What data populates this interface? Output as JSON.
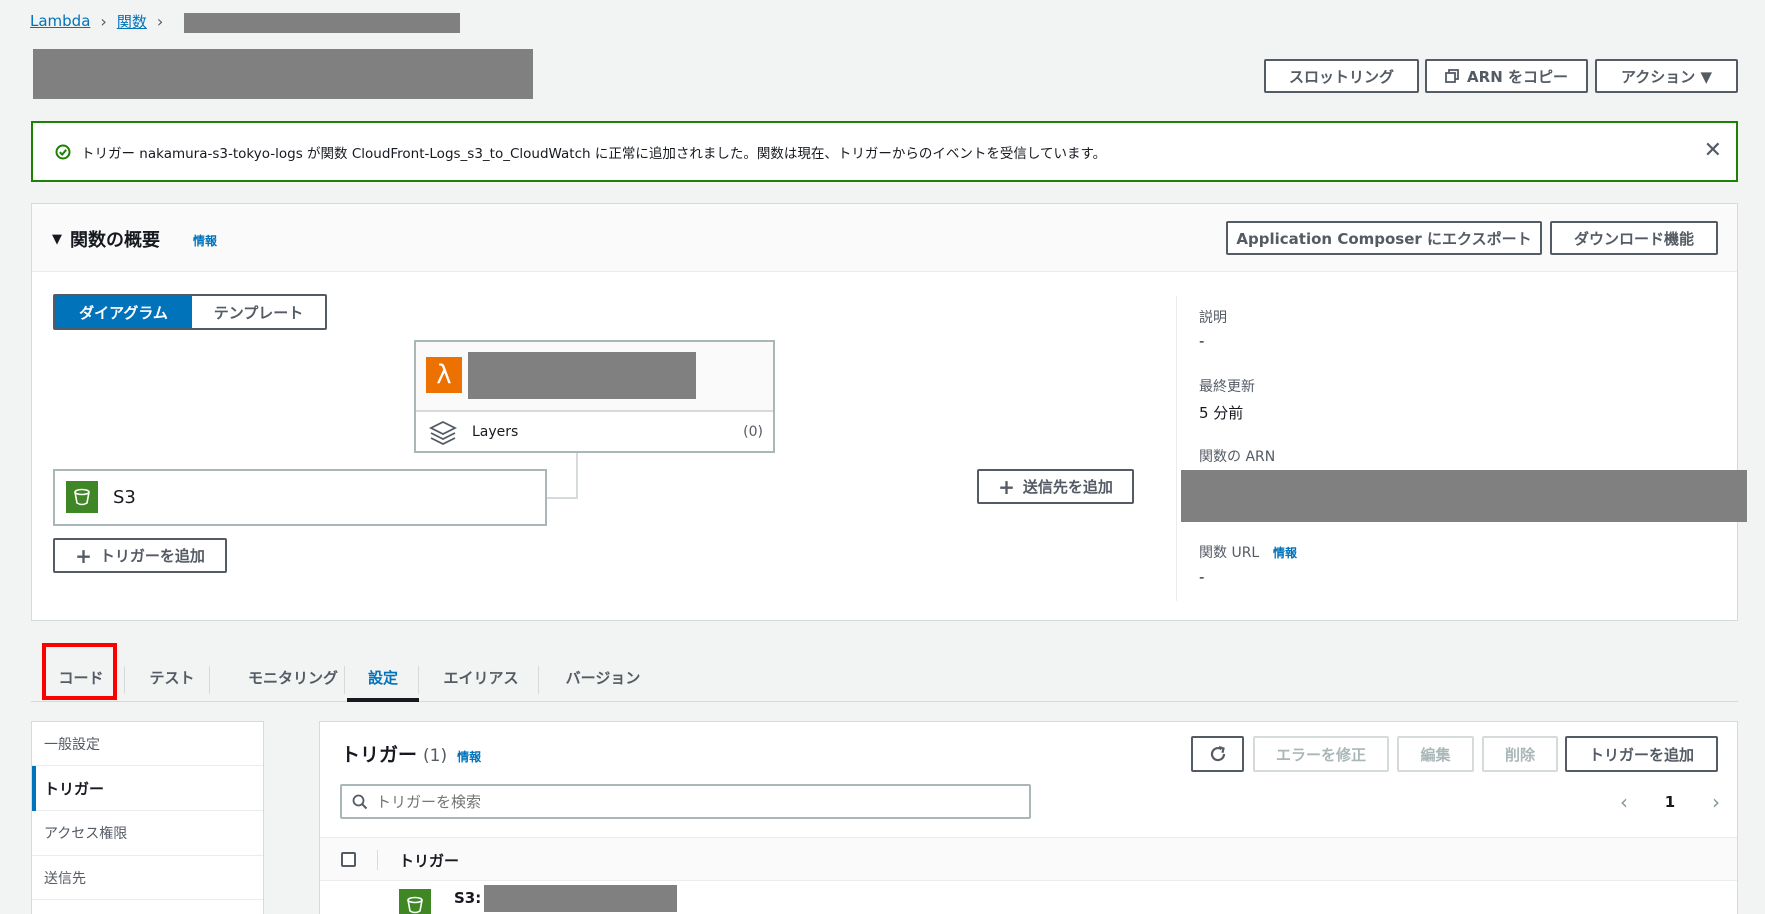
{
  "breadcrumb": {
    "root": "Lambda",
    "functions": "関数"
  },
  "header": {
    "throttle_label": "スロットリング",
    "copy_arn_label": "ARN をコピー",
    "actions_label": "アクション ▼"
  },
  "flash": {
    "message": "トリガー nakamura-s3-tokyo-logs が関数 CloudFront-Logs_s3_to_CloudWatch に正常に追加されました。関数は現在、トリガーからのイベントを受信しています。"
  },
  "overview": {
    "title": "関数の概要",
    "info": "情報",
    "export_label": "Application Composer にエクスポート",
    "download_label": "ダウンロード機能",
    "toggle_diagram": "ダイアグラム",
    "toggle_template": "テンプレート",
    "lambda_icon_glyph": "λ",
    "layers_label": "Layers",
    "layers_count": "(0)",
    "trigger_name": "S3",
    "add_trigger_label": "トリガーを追加",
    "add_destination_label": "送信先を追加",
    "description_label": "説明",
    "description_value": "-",
    "last_modified_label": "最終更新",
    "last_modified_value": "5 分前",
    "arn_label": "関数の ARN",
    "url_label": "関数 URL",
    "url_info": "情報",
    "url_value": "-"
  },
  "tabs": [
    "コード",
    "テスト",
    "モニタリング",
    "設定",
    "エイリアス",
    "バージョン"
  ],
  "active_tab": "設定",
  "sidenav": [
    "一般設定",
    "トリガー",
    "アクセス権限",
    "送信先"
  ],
  "triggers": {
    "title": "トリガー",
    "count": "(1)",
    "info": "情報",
    "fix_errors": "エラーを修正",
    "edit": "編集",
    "delete": "削除",
    "add": "トリガーを追加",
    "search_placeholder": "トリガーを検索",
    "page": "1",
    "column_trigger": "トリガー",
    "row_prefix": "S3:"
  },
  "colors": {
    "accent": "#0073bb",
    "highlight": "#ff0000",
    "success": "#1d8102",
    "lambda": "#ed7100",
    "s3": "#3f8624"
  }
}
